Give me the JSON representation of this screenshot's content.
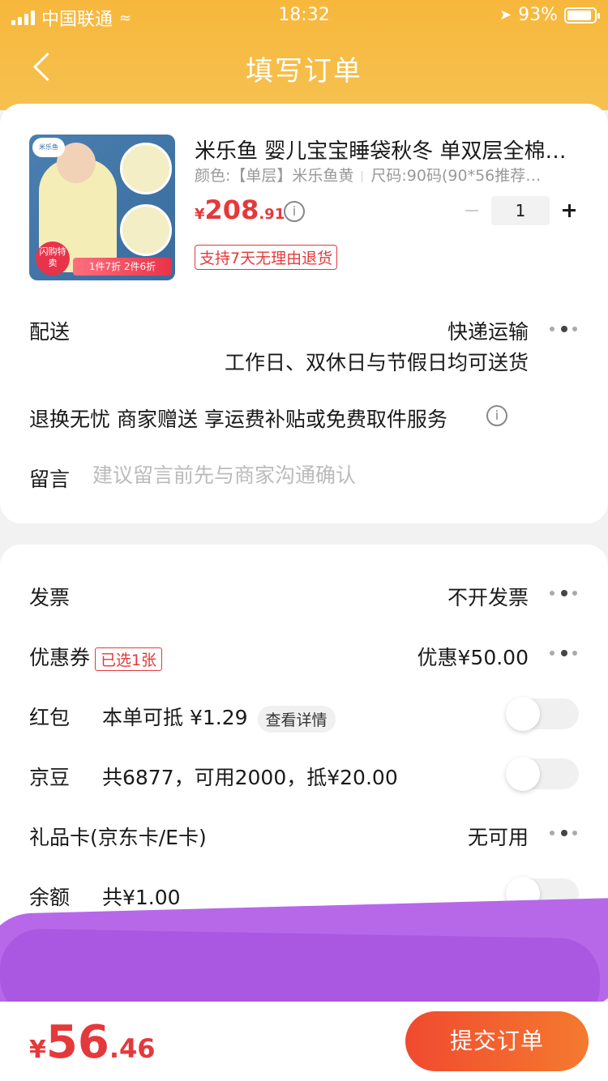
{
  "status_bar": {
    "carrier": "中国联通",
    "time": "18:32",
    "battery": "93%"
  },
  "nav": {
    "title": "填写订单"
  },
  "product": {
    "title": "米乐鱼 婴儿宝宝睡袋秋冬 单双层全棉…",
    "color": "颜色:【单层】米乐鱼黄",
    "size": "尺码:90码(90*56推荐…",
    "price_symbol": "¥",
    "price_int": "208",
    "price_dec": ".91",
    "quantity": "1",
    "return_tag": "支持7天无理由退货",
    "image": {
      "logo": "米乐鱼",
      "badge": "闪购特卖",
      "promo": "1件7折 2件6折"
    }
  },
  "delivery": {
    "label": "配送",
    "method": "快递运输",
    "note": "工作日、双休日与节假日均可送货"
  },
  "service": {
    "text": "退换无忧 商家赠送 享运费补贴或免费取件服务"
  },
  "message": {
    "label": "留言",
    "placeholder": "建议留言前先与商家沟通确认"
  },
  "invoice": {
    "label": "发票",
    "value": "不开发票"
  },
  "coupon": {
    "label": "优惠券",
    "badge": "已选1张",
    "value": "优惠¥50.00"
  },
  "red_packet": {
    "label": "红包",
    "text": "本单可抵 ¥1.29",
    "detail": "查看详情",
    "enabled": false
  },
  "jd_beans": {
    "label": "京豆",
    "text": "共6877，可用2000，抵¥20.00",
    "enabled": false
  },
  "gift_card": {
    "label": "礼品卡(京东卡/E卡)",
    "value": "无可用"
  },
  "balance": {
    "label": "余额",
    "text": "共¥1.00",
    "enabled": false
  },
  "footer": {
    "price_symbol": "¥",
    "price_int": "56",
    "price_dec": ".46",
    "submit": "提交订单"
  },
  "colors": {
    "brand_orange": "#f7b73c",
    "price_red": "#e4393c",
    "submit_start": "#f04a2f",
    "submit_end": "#f57a2f"
  }
}
